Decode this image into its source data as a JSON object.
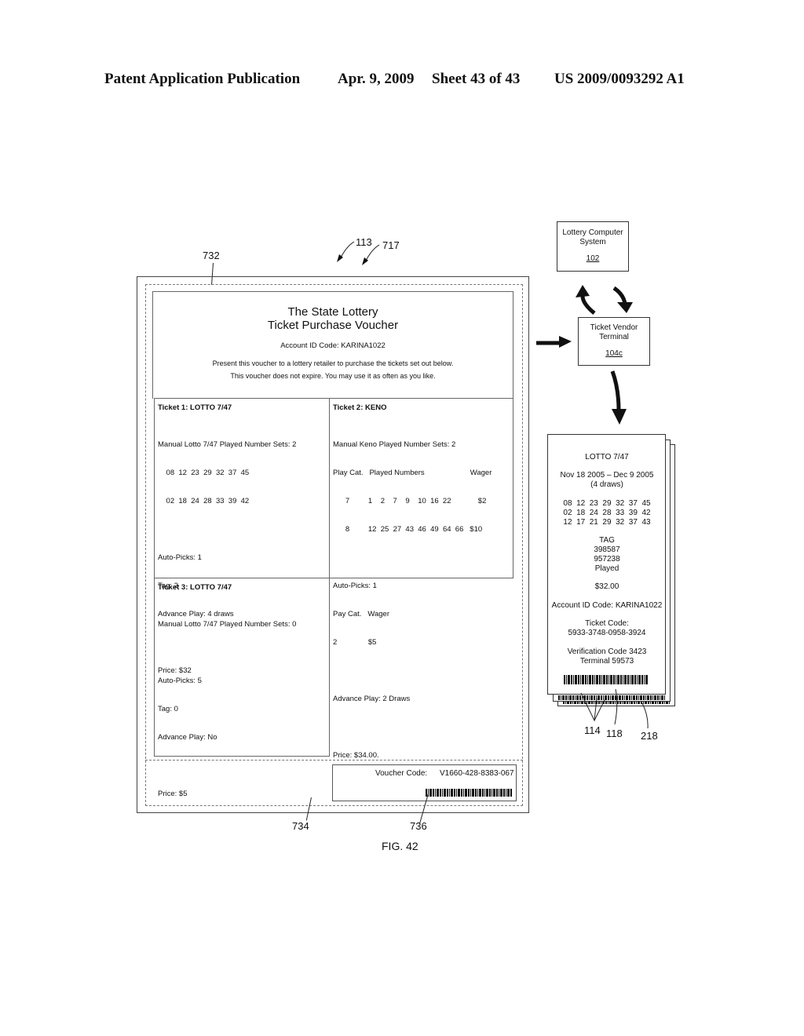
{
  "header": {
    "publication": "Patent Application Publication",
    "date": "Apr. 9, 2009",
    "sheet": "Sheet 43 of 43",
    "number": "US 2009/0093292 A1"
  },
  "refs": {
    "r732": "732",
    "r113": "113",
    "r717": "717",
    "r734": "734",
    "r736": "736",
    "r114": "114",
    "r118": "118",
    "r218": "218"
  },
  "voucher": {
    "title": "The State Lottery",
    "subtitle": "Ticket Purchase Voucher",
    "account": "Account ID Code: KARINA1022",
    "instructions": "Present this voucher to a lottery retailer to purchase the tickets set out below.",
    "expiry": "This voucher does not expire.  You may use it as often as you like.",
    "tickets": [
      {
        "title": "Ticket 1: LOTTO 7/47",
        "lines": [
          "Manual Lotto 7/47 Played Number Sets: 2",
          "    08  12  23  29  32  37  45",
          "    02  18  24  28  33  39  42",
          "",
          "Auto-Picks: 1",
          "Tag: 2",
          "Advance Play: 4 draws",
          "",
          "Price: $32"
        ]
      },
      {
        "title": "Ticket 2: KENO",
        "lines": [
          "Manual Keno Played Number Sets: 2",
          "Play Cat.   Played Numbers                      Wager",
          "      7         1    2    7    9    10  16  22             $2",
          "      8         12  25  27  43  46  49  64  66   $10",
          "",
          "Auto-Picks: 1",
          "Pay Cat.   Wager",
          "2               $5",
          "",
          "Advance Play: 2 Draws",
          "",
          "Price: $34.00."
        ]
      },
      {
        "title": "Ticket 3: LOTTO 7/47",
        "lines": [
          "Manual Lotto 7/47 Played Number Sets: 0",
          "",
          "Auto-Picks: 5",
          "Tag: 0",
          "Advance Play: No",
          "",
          "Price: $5"
        ]
      }
    ],
    "voucher_code_label": "Voucher Code:",
    "voucher_code": "V1660-428-8383-067"
  },
  "flow": {
    "lcs": {
      "line1": "Lottery Computer",
      "line2": "System",
      "num": "102"
    },
    "tvt": {
      "line1": "Ticket Vendor",
      "line2": "Terminal",
      "num": "104c"
    }
  },
  "printed_ticket": {
    "game": "LOTTO 7/47",
    "dates": "Nov 18 2005 – Dec 9 2005",
    "draws": "(4 draws)",
    "numbers": [
      "08  12  23  29  32  37  45",
      "02  18  24  28  33  39  42",
      "12  17  21  29  32  37  43"
    ],
    "tag_label": "TAG",
    "tag_1": "398587",
    "tag_2": "957238",
    "tag_status": "Played",
    "price": "$32.00",
    "account": "Account ID Code: KARINA1022",
    "ticket_code_label": "Ticket Code:",
    "ticket_code": "5933-3748-0958-3924",
    "verification": "Verification Code 3423",
    "terminal": "Terminal 59573"
  },
  "figure_label": "FIG. 42"
}
